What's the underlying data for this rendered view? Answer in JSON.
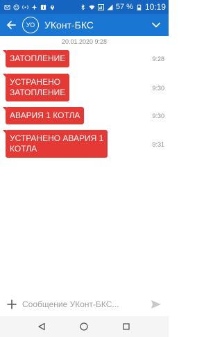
{
  "status_bar": {
    "battery_percent": "57 %",
    "time": "10:19",
    "icons": [
      "mail-icon",
      "smile-icon",
      "hotspot-icon",
      "spark-icon",
      "info-icon",
      "location-icon",
      "bluetooth-icon",
      "wifi-icon",
      "lte-icon",
      "signal-icon",
      "battery-icon"
    ]
  },
  "header": {
    "avatar_initials": "УО",
    "title": "УКонт-БКС"
  },
  "chat": {
    "date": "20.01.2020 9:28",
    "messages": [
      {
        "lines": [
          "ЗАТОПЛЕНИЕ"
        ],
        "time": "9:28"
      },
      {
        "lines": [
          "УСТРАНЕНО",
          "ЗАТОПЛЕНИЕ"
        ],
        "time": "9:30"
      },
      {
        "lines": [
          "АВАРИЯ 1 КОТЛА"
        ],
        "time": "9:30"
      },
      {
        "lines": [
          "УСТРАНЕНО АВАРИЯ 1",
          "КОТЛА"
        ],
        "time": "9:31"
      }
    ]
  },
  "composer": {
    "placeholder": "Сообщение УКонт-БКС..."
  },
  "colors": {
    "status_bar": "#1565c0",
    "app_bar": "#1976d2",
    "bubble": "#e53935",
    "muted_text": "#8a8a8a"
  }
}
